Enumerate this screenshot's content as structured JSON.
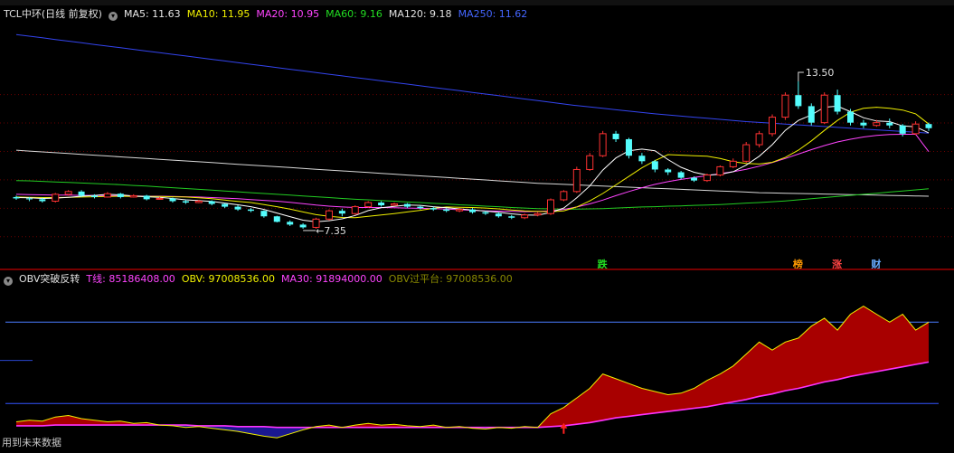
{
  "main": {
    "title": "TCL中环(日线 前复权)",
    "indicators": [
      {
        "label": "MA5: 11.63",
        "color": "#e8e8e8"
      },
      {
        "label": "MA10: 11.95",
        "color": "#f0f000"
      },
      {
        "label": "MA20: 10.95",
        "color": "#ff44ff"
      },
      {
        "label": "MA60: 9.16",
        "color": "#22dd22"
      },
      {
        "label": "MA120: 9.18",
        "color": "#e0e0e0"
      },
      {
        "label": "MA250: 11.62",
        "color": "#4466ff"
      }
    ],
    "annotations": {
      "high_label": "13.50",
      "low_label": "7.35"
    },
    "markers": [
      {
        "text": "跌",
        "color": "#22dd22"
      },
      {
        "text": "榜",
        "color": "#ff9900"
      },
      {
        "text": "涨",
        "color": "#ff4444"
      },
      {
        "text": "财",
        "color": "#66aaff"
      }
    ]
  },
  "indicator_pane": {
    "title": "OBV突破反转",
    "values": [
      {
        "label": "T线: 85186408.00",
        "color": "#ff44ff"
      },
      {
        "label": "OBV: 97008536.00",
        "color": "#f0f000"
      },
      {
        "label": "MA30: 91894000.00",
        "color": "#ff44ff"
      },
      {
        "label": "OBV过平台: 97008536.00",
        "color": "#888800"
      }
    ],
    "future_note": "用到未来数据"
  },
  "chart_data": {
    "type": "candlestick",
    "candles": [
      [
        9.3,
        9.25,
        9.35,
        9.2
      ],
      [
        9.25,
        9.22,
        9.3,
        9.15
      ],
      [
        9.22,
        9.15,
        9.28,
        9.1
      ],
      [
        9.15,
        9.4,
        9.45,
        9.1
      ],
      [
        9.4,
        9.5,
        9.55,
        9.35
      ],
      [
        9.5,
        9.35,
        9.55,
        9.3
      ],
      [
        9.35,
        9.3,
        9.4,
        9.25
      ],
      [
        9.3,
        9.42,
        9.48,
        9.28
      ],
      [
        9.42,
        9.3,
        9.45,
        9.25
      ],
      [
        9.3,
        9.35,
        9.4,
        9.28
      ],
      [
        9.35,
        9.22,
        9.38,
        9.18
      ],
      [
        9.22,
        9.25,
        9.3,
        9.2
      ],
      [
        9.25,
        9.15,
        9.28,
        9.1
      ],
      [
        9.15,
        9.1,
        9.2,
        9.05
      ],
      [
        9.1,
        9.15,
        9.2,
        9.08
      ],
      [
        9.15,
        9.05,
        9.18,
        9.0
      ],
      [
        9.05,
        8.95,
        9.08,
        8.9
      ],
      [
        8.95,
        8.85,
        9.0,
        8.8
      ],
      [
        8.85,
        8.8,
        8.9,
        8.75
      ],
      [
        8.8,
        8.6,
        8.82,
        8.55
      ],
      [
        8.6,
        8.4,
        8.62,
        8.38
      ],
      [
        8.4,
        8.3,
        8.45,
        8.25
      ],
      [
        8.3,
        8.2,
        8.35,
        8.15
      ],
      [
        8.2,
        8.5,
        8.55,
        8.15
      ],
      [
        8.5,
        8.8,
        8.85,
        8.45
      ],
      [
        8.8,
        8.7,
        8.88,
        8.6
      ],
      [
        8.7,
        8.95,
        9.0,
        8.65
      ],
      [
        8.95,
        9.1,
        9.15,
        8.9
      ],
      [
        9.1,
        9.0,
        9.15,
        8.95
      ],
      [
        9.0,
        9.05,
        9.1,
        8.98
      ],
      [
        9.05,
        8.95,
        9.08,
        8.9
      ],
      [
        8.95,
        8.9,
        9.0,
        8.85
      ],
      [
        8.9,
        8.85,
        8.95,
        8.8
      ],
      [
        8.85,
        8.8,
        8.9,
        8.75
      ],
      [
        8.8,
        8.85,
        8.9,
        8.75
      ],
      [
        8.85,
        8.75,
        8.9,
        8.7
      ],
      [
        8.75,
        8.7,
        8.8,
        8.65
      ],
      [
        8.7,
        8.6,
        8.75,
        8.55
      ],
      [
        8.6,
        8.55,
        8.65,
        8.5
      ],
      [
        8.55,
        8.65,
        8.7,
        8.5
      ],
      [
        8.65,
        8.7,
        8.75,
        8.6
      ],
      [
        8.7,
        9.2,
        9.25,
        8.65
      ],
      [
        9.2,
        9.5,
        9.55,
        9.15
      ],
      [
        9.5,
        10.3,
        10.4,
        9.45
      ],
      [
        10.3,
        10.8,
        10.9,
        10.25
      ],
      [
        10.8,
        11.6,
        11.7,
        10.75
      ],
      [
        11.6,
        11.4,
        11.7,
        11.3
      ],
      [
        11.4,
        10.8,
        11.45,
        10.7
      ],
      [
        10.8,
        10.6,
        10.9,
        10.5
      ],
      [
        10.6,
        10.3,
        10.65,
        10.2
      ],
      [
        10.3,
        10.2,
        10.35,
        10.1
      ],
      [
        10.2,
        10.0,
        10.25,
        9.95
      ],
      [
        10.0,
        9.9,
        10.05,
        9.85
      ],
      [
        9.9,
        10.1,
        10.15,
        9.85
      ],
      [
        10.1,
        10.4,
        10.45,
        10.05
      ],
      [
        10.4,
        10.6,
        10.7,
        10.35
      ],
      [
        10.6,
        11.2,
        11.3,
        10.55
      ],
      [
        11.2,
        11.6,
        11.7,
        11.1
      ],
      [
        11.6,
        12.2,
        12.3,
        11.5
      ],
      [
        12.2,
        13.0,
        13.1,
        12.1
      ],
      [
        13.0,
        12.6,
        13.5,
        12.5
      ],
      [
        12.6,
        12.0,
        12.7,
        11.9
      ],
      [
        12.0,
        13.0,
        13.1,
        11.95
      ],
      [
        13.0,
        12.4,
        13.2,
        12.3
      ],
      [
        12.4,
        12.0,
        12.5,
        11.9
      ],
      [
        12.0,
        11.9,
        12.1,
        11.8
      ],
      [
        11.9,
        12.0,
        12.1,
        11.85
      ],
      [
        12.0,
        11.9,
        12.15,
        11.8
      ],
      [
        11.9,
        11.6,
        11.95,
        11.5
      ],
      [
        11.6,
        11.95,
        12.05,
        11.55
      ],
      [
        11.95,
        11.8,
        12.0,
        11.7
      ]
    ],
    "ma5": [
      9.28,
      9.27,
      9.25,
      9.26,
      9.29,
      9.33,
      9.36,
      9.4,
      9.38,
      9.34,
      9.31,
      9.29,
      9.25,
      9.2,
      9.17,
      9.14,
      9.08,
      9.02,
      8.95,
      8.85,
      8.72,
      8.59,
      8.46,
      8.4,
      8.44,
      8.51,
      8.63,
      8.81,
      8.91,
      8.96,
      9.01,
      9.0,
      8.95,
      8.91,
      8.87,
      8.83,
      8.79,
      8.75,
      8.69,
      8.65,
      8.64,
      8.74,
      8.9,
      9.27,
      9.7,
      10.28,
      10.72,
      10.98,
      11.04,
      10.98,
      10.66,
      10.38,
      10.2,
      10.1,
      10.12,
      10.22,
      10.46,
      10.78,
      11.2,
      11.72,
      12.08,
      12.28,
      12.56,
      12.6,
      12.4,
      12.18,
      12.06,
      12.04,
      11.88,
      11.85,
      11.63
    ],
    "ma10": [
      9.3,
      9.29,
      9.28,
      9.28,
      9.29,
      9.3,
      9.31,
      9.32,
      9.33,
      9.32,
      9.32,
      9.32,
      9.31,
      9.3,
      9.27,
      9.24,
      9.19,
      9.14,
      9.1,
      9.03,
      8.95,
      8.86,
      8.76,
      8.66,
      8.6,
      8.56,
      8.55,
      8.6,
      8.65,
      8.7,
      8.76,
      8.82,
      8.89,
      8.94,
      8.93,
      8.92,
      8.9,
      8.87,
      8.83,
      8.8,
      8.78,
      8.77,
      8.8,
      8.94,
      9.16,
      9.43,
      9.74,
      10.05,
      10.36,
      10.62,
      10.84,
      10.82,
      10.8,
      10.78,
      10.7,
      10.58,
      10.52,
      10.5,
      10.56,
      10.74,
      11.0,
      11.34,
      11.72,
      12.08,
      12.38,
      12.52,
      12.56,
      12.52,
      12.46,
      12.32,
      11.95
    ],
    "ma20": [
      9.4,
      9.39,
      9.38,
      9.37,
      9.37,
      9.36,
      9.36,
      9.35,
      9.35,
      9.34,
      9.33,
      9.33,
      9.32,
      9.31,
      9.3,
      9.28,
      9.26,
      9.24,
      9.21,
      9.18,
      9.15,
      9.11,
      9.06,
      9.01,
      8.97,
      8.94,
      8.92,
      8.92,
      8.92,
      8.91,
      8.9,
      8.89,
      8.88,
      8.86,
      8.84,
      8.82,
      8.8,
      8.79,
      8.78,
      8.77,
      8.78,
      8.8,
      8.85,
      8.94,
      9.05,
      9.19,
      9.35,
      9.5,
      9.64,
      9.76,
      9.86,
      9.94,
      10.01,
      10.08,
      10.15,
      10.22,
      10.31,
      10.42,
      10.55,
      10.7,
      10.86,
      11.02,
      11.17,
      11.3,
      11.4,
      11.48,
      11.54,
      11.57,
      11.58,
      11.58,
      10.95
    ],
    "ma60": [
      9.9,
      9.89,
      9.87,
      9.85,
      9.83,
      9.81,
      9.79,
      9.77,
      9.75,
      9.72,
      9.7,
      9.67,
      9.64,
      9.61,
      9.58,
      9.55,
      9.52,
      9.49,
      9.46,
      9.43,
      9.4,
      9.37,
      9.34,
      9.31,
      9.28,
      9.25,
      9.22,
      9.2,
      9.17,
      9.15,
      9.12,
      9.1,
      9.07,
      9.05,
      9.02,
      9.0,
      8.97,
      8.95,
      8.92,
      8.9,
      8.88,
      8.87,
      8.86,
      8.86,
      8.87,
      8.88,
      8.9,
      8.92,
      8.94,
      8.95,
      8.97,
      8.98,
      9.0,
      9.01,
      9.03,
      9.05,
      9.08,
      9.1,
      9.13,
      9.16,
      9.2,
      9.24,
      9.28,
      9.32,
      9.36,
      9.4,
      9.44,
      9.48,
      9.52,
      9.56,
      9.6
    ],
    "ma120": [
      11.0,
      10.97,
      10.94,
      10.91,
      10.88,
      10.85,
      10.82,
      10.79,
      10.76,
      10.73,
      10.7,
      10.67,
      10.64,
      10.61,
      10.58,
      10.55,
      10.52,
      10.49,
      10.46,
      10.43,
      10.4,
      10.37,
      10.34,
      10.31,
      10.28,
      10.25,
      10.22,
      10.19,
      10.16,
      10.13,
      10.1,
      10.07,
      10.04,
      10.01,
      9.98,
      9.95,
      9.92,
      9.89,
      9.86,
      9.83,
      9.8,
      9.78,
      9.76,
      9.74,
      9.72,
      9.7,
      9.68,
      9.66,
      9.64,
      9.62,
      9.6,
      9.58,
      9.56,
      9.54,
      9.52,
      9.5,
      9.48,
      9.46,
      9.45,
      9.44,
      9.43,
      9.42,
      9.41,
      9.4,
      9.39,
      9.38,
      9.37,
      9.36,
      9.35,
      9.34,
      9.33
    ],
    "ma250": [
      15.2,
      15.14,
      15.08,
      15.02,
      14.96,
      14.9,
      14.84,
      14.78,
      14.72,
      14.66,
      14.6,
      14.54,
      14.48,
      14.42,
      14.36,
      14.3,
      14.24,
      14.18,
      14.12,
      14.06,
      14.0,
      13.94,
      13.88,
      13.82,
      13.76,
      13.7,
      13.64,
      13.58,
      13.52,
      13.46,
      13.4,
      13.34,
      13.28,
      13.22,
      13.16,
      13.1,
      13.04,
      12.98,
      12.92,
      12.86,
      12.8,
      12.74,
      12.68,
      12.62,
      12.57,
      12.52,
      12.47,
      12.42,
      12.37,
      12.32,
      12.28,
      12.24,
      12.2,
      12.16,
      12.12,
      12.08,
      12.04,
      12.01,
      11.98,
      11.95,
      11.92,
      11.89,
      11.86,
      11.83,
      11.8,
      11.77,
      11.74,
      11.71,
      11.68,
      11.65,
      11.62
    ],
    "obv": [
      0.2,
      0.22,
      0.21,
      0.26,
      0.28,
      0.24,
      0.22,
      0.2,
      0.21,
      0.18,
      0.19,
      0.16,
      0.15,
      0.13,
      0.14,
      0.12,
      0.1,
      0.08,
      0.05,
      0.02,
      0.0,
      0.05,
      0.1,
      0.14,
      0.16,
      0.13,
      0.16,
      0.18,
      0.16,
      0.17,
      0.15,
      0.14,
      0.16,
      0.13,
      0.14,
      0.12,
      0.11,
      0.13,
      0.12,
      0.14,
      0.13,
      0.3,
      0.38,
      0.5,
      0.62,
      0.8,
      0.74,
      0.68,
      0.62,
      0.58,
      0.54,
      0.56,
      0.62,
      0.72,
      0.8,
      0.9,
      1.05,
      1.2,
      1.1,
      1.2,
      1.25,
      1.4,
      1.5,
      1.35,
      1.55,
      1.65,
      1.55,
      1.45,
      1.55,
      1.35,
      1.45
    ],
    "obv_ma30": [
      0.15,
      0.15,
      0.15,
      0.16,
      0.16,
      0.16,
      0.16,
      0.16,
      0.16,
      0.16,
      0.16,
      0.16,
      0.16,
      0.16,
      0.15,
      0.15,
      0.15,
      0.14,
      0.14,
      0.14,
      0.13,
      0.13,
      0.13,
      0.13,
      0.13,
      0.13,
      0.13,
      0.13,
      0.13,
      0.13,
      0.13,
      0.13,
      0.13,
      0.13,
      0.13,
      0.13,
      0.13,
      0.13,
      0.13,
      0.13,
      0.13,
      0.14,
      0.15,
      0.17,
      0.19,
      0.22,
      0.25,
      0.27,
      0.29,
      0.31,
      0.33,
      0.35,
      0.37,
      0.39,
      0.42,
      0.45,
      0.48,
      0.52,
      0.55,
      0.59,
      0.62,
      0.66,
      0.7,
      0.73,
      0.77,
      0.8,
      0.83,
      0.86,
      0.89,
      0.92,
      0.95
    ],
    "ylim_price": [
      7.0,
      15.6
    ],
    "ylim_obv": [
      -0.1,
      1.85
    ],
    "obv_levels": [
      1.45,
      0.97,
      0.43
    ]
  }
}
